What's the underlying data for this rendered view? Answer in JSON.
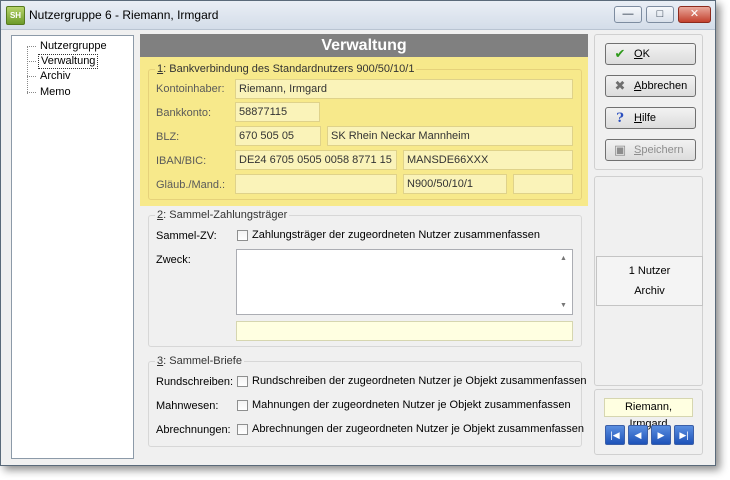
{
  "window": {
    "title": "Nutzergruppe 6 - Riemann, Irmgard",
    "icon_text": "SH",
    "controls": {
      "minimize": "—",
      "maximize": "□",
      "close": "✕"
    }
  },
  "tree": {
    "items": [
      {
        "label": "Nutzergruppe",
        "selected": false
      },
      {
        "label": "Verwaltung",
        "selected": true
      },
      {
        "label": "Archiv",
        "selected": false
      },
      {
        "label": "Memo",
        "selected": false
      }
    ]
  },
  "panel": {
    "title": "Verwaltung",
    "bank": {
      "legend_num": "1",
      "legend_text": ": Bankverbindung des Standardnutzers 900/50/10/1",
      "labels": {
        "owner": "Kontoinhaber:",
        "account": "Bankkonto:",
        "blz": "BLZ:",
        "iban_bic": "IBAN/BIC:",
        "creditor": "Gläub./Mand.:"
      },
      "owner": "Riemann, Irmgard",
      "account": "58877115",
      "blz": "670 505 05",
      "bank_name": "SK Rhein Neckar Mannheim",
      "iban": "DE24 6705 0505 0058 8771 15",
      "bic": "MANSDE66XXX",
      "creditor_id": "",
      "mandate": "N900/50/10/1",
      "extra": ""
    },
    "collective_payer": {
      "legend_num": "2",
      "legend_text": ": Sammel-Zahlungsträger",
      "label": "Sammel-ZV:",
      "checkbox_label": "Zahlungsträger der zugeordneten Nutzer zusammenfassen",
      "purpose_label": "Zweck:",
      "purpose_text": "",
      "extra_field": ""
    },
    "collective_letters": {
      "legend_num": "3",
      "legend_text": ": Sammel-Briefe",
      "rows": [
        {
          "label": "Rundschreiben:",
          "checkbox_label": "Rundschreiben der zugeordneten Nutzer je Objekt zusammenfassen"
        },
        {
          "label": "Mahnwesen:",
          "checkbox_label": "Mahnungen der zugeordneten Nutzer je Objekt zusammenfassen"
        },
        {
          "label": "Abrechnungen:",
          "checkbox_label": "Abrechnungen der zugeordneten Nutzer je Objekt zusammenfassen"
        }
      ]
    }
  },
  "buttons": {
    "ok": {
      "mnemonic": "O",
      "rest": "K"
    },
    "cancel": {
      "mnemonic": "A",
      "rest": "bbrechen"
    },
    "help": {
      "mnemonic": "H",
      "rest": "ilfe"
    },
    "save": {
      "mnemonic": "S",
      "rest": "peichern"
    }
  },
  "info": {
    "line1": "1 Nutzer",
    "line2": "Archiv"
  },
  "navigator": {
    "name": "Riemann, Irmgard",
    "first": "|◀",
    "prev": "◀",
    "next": "▶",
    "last": "▶|"
  }
}
